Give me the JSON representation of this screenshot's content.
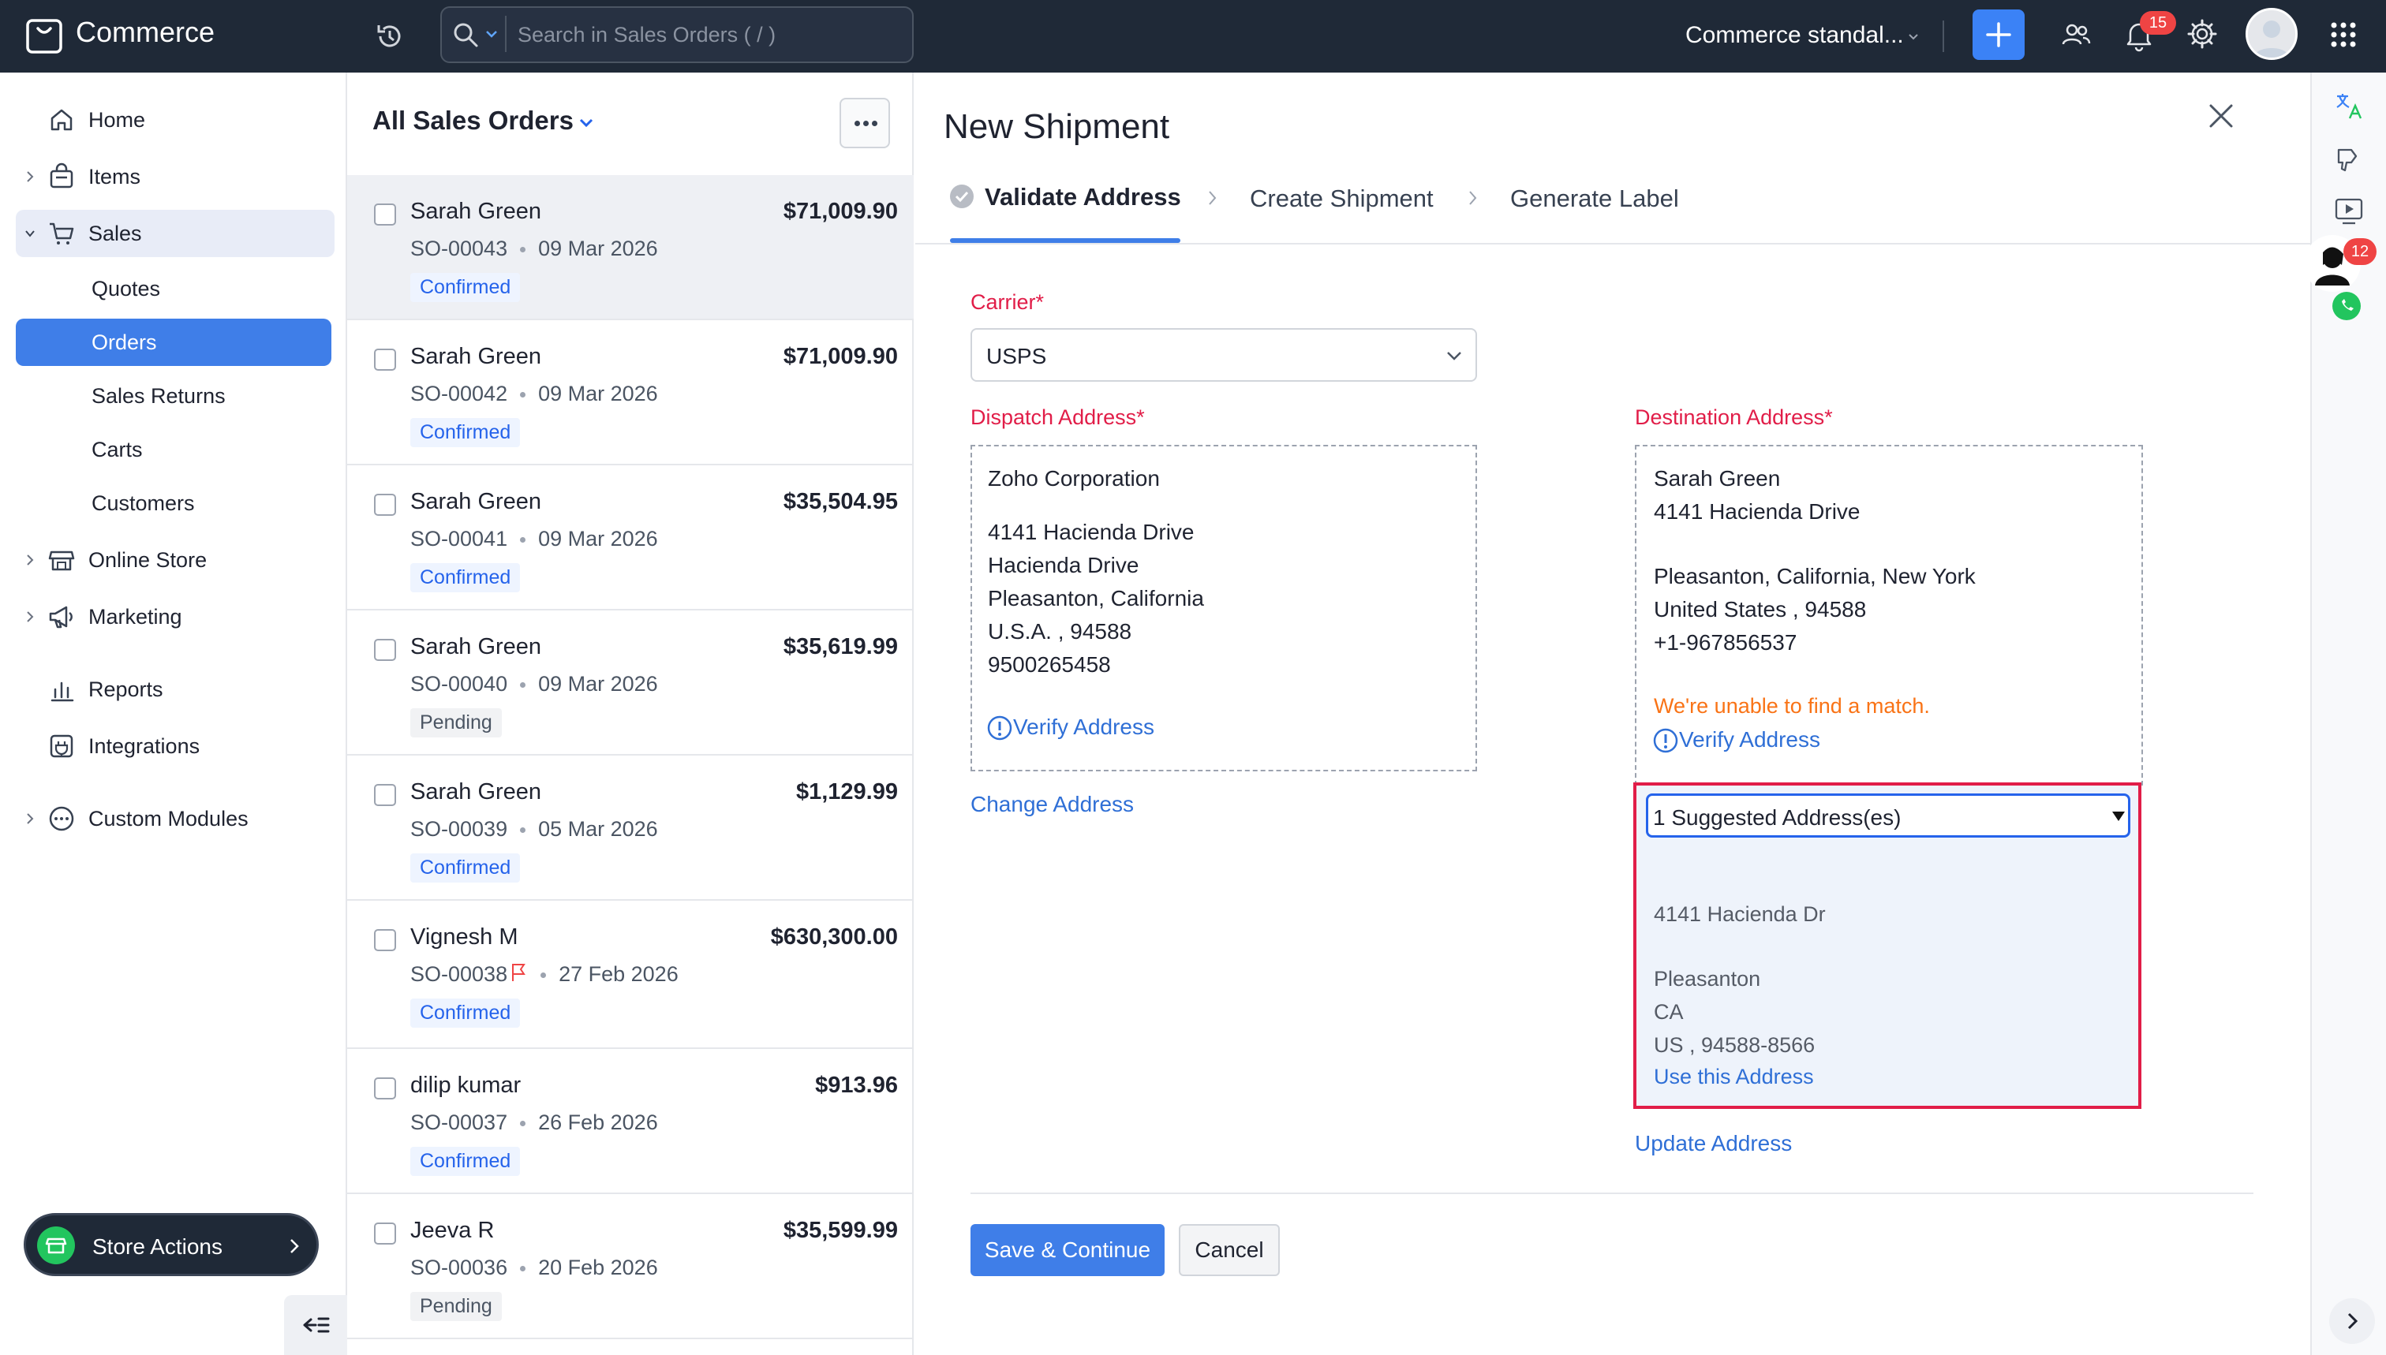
{
  "app": {
    "name": "Commerce",
    "org_name": "Commerce standal...",
    "notification_count": "15",
    "search_placeholder": "Search in Sales Orders ( / )"
  },
  "sidebar": {
    "items": [
      {
        "label": "Home",
        "icon": "home-icon"
      },
      {
        "label": "Items",
        "icon": "bag-icon"
      },
      {
        "label": "Sales",
        "icon": "cart-icon"
      },
      {
        "label": "Quotes"
      },
      {
        "label": "Orders"
      },
      {
        "label": "Sales Returns"
      },
      {
        "label": "Carts"
      },
      {
        "label": "Customers"
      },
      {
        "label": "Online Store",
        "icon": "store-icon"
      },
      {
        "label": "Marketing",
        "icon": "megaphone-icon"
      },
      {
        "label": "Reports",
        "icon": "bar-chart-icon"
      },
      {
        "label": "Integrations",
        "icon": "plug-icon"
      },
      {
        "label": "Custom Modules",
        "icon": "dots-circle-icon"
      }
    ],
    "store_actions": "Store Actions"
  },
  "list": {
    "title": "All Sales Orders",
    "orders": [
      {
        "customer": "Sarah Green",
        "amount": "$71,009.90",
        "number": "SO-00043",
        "date": "09 Mar 2026",
        "status": "Confirmed"
      },
      {
        "customer": "Sarah Green",
        "amount": "$71,009.90",
        "number": "SO-00042",
        "date": "09 Mar 2026",
        "status": "Confirmed"
      },
      {
        "customer": "Sarah Green",
        "amount": "$35,504.95",
        "number": "SO-00041",
        "date": "09 Mar 2026",
        "status": "Confirmed"
      },
      {
        "customer": "Sarah Green",
        "amount": "$35,619.99",
        "number": "SO-00040",
        "date": "09 Mar 2026",
        "status": "Pending"
      },
      {
        "customer": "Sarah Green",
        "amount": "$1,129.99",
        "number": "SO-00039",
        "date": "05 Mar 2026",
        "status": "Confirmed"
      },
      {
        "customer": "Vignesh M",
        "amount": "$630,300.00",
        "number": "SO-00038",
        "date": "27 Feb 2026",
        "status": "Confirmed"
      },
      {
        "customer": "dilip kumar",
        "amount": "$913.96",
        "number": "SO-00037",
        "date": "26 Feb 2026",
        "status": "Confirmed"
      },
      {
        "customer": "Jeeva R",
        "amount": "$35,599.99",
        "number": "SO-00036",
        "date": "20 Feb 2026",
        "status": "Pending"
      }
    ]
  },
  "shipment": {
    "title": "New Shipment",
    "steps": [
      "Validate Address",
      "Create Shipment",
      "Generate Label"
    ],
    "carrier_label": "Carrier*",
    "carrier_value": "USPS",
    "dispatch_label": "Dispatch Address*",
    "dispatch": {
      "company": "Zoho Corporation",
      "line1": "4141 Hacienda Drive",
      "line2": "Hacienda Drive",
      "city_state": "Pleasanton, California",
      "country_zip": "U.S.A. , 94588",
      "phone": "9500265458"
    },
    "verify_address": "Verify Address",
    "change_address": "Change Address",
    "destination_label": "Destination Address*",
    "destination": {
      "name": "Sarah Green",
      "line1": "4141 Hacienda Drive",
      "city_state": "Pleasanton, California, New York",
      "country_zip": "United States , 94588",
      "phone": "+1-967856537"
    },
    "no_match": "We're unable to find a match.",
    "suggested_select": "1 Suggested Address(es)",
    "suggested": {
      "line1": "4141 Hacienda Dr",
      "city": "Pleasanton",
      "state": "CA",
      "country_zip": "US , 94588-8566"
    },
    "use_this": "Use this Address",
    "update_address": "Update Address",
    "save": "Save & Continue",
    "cancel": "Cancel"
  },
  "rail": {
    "chat_badge": "12"
  },
  "colors": {
    "accent": "#3f7ee8",
    "required": "#e11d48",
    "highlight_border": "#e11d48",
    "warning": "#f97316",
    "topbar": "#1f2937"
  }
}
